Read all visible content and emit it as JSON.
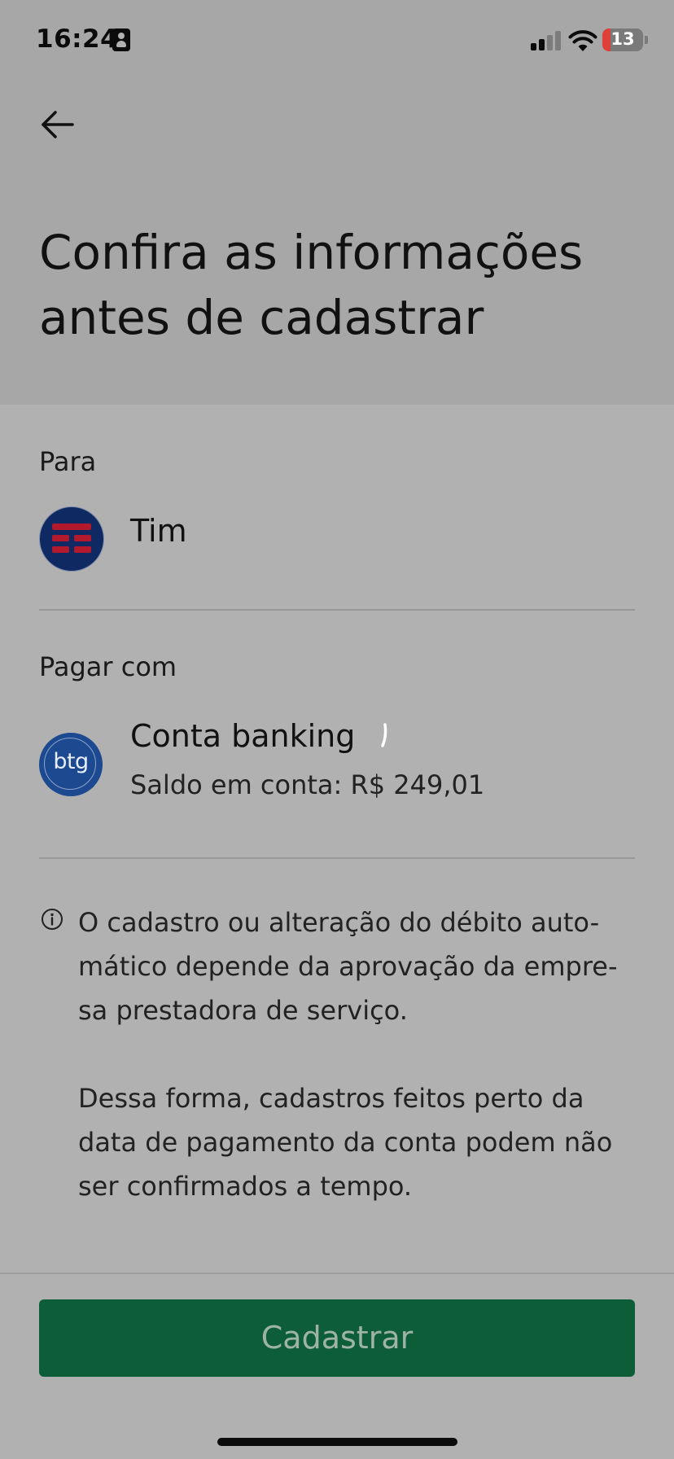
{
  "status_bar": {
    "time": "16:24",
    "battery_level": "13",
    "battery_color": "#e0403a",
    "id_icon": "person-id-icon",
    "signal_icon": "cellular-signal-icon",
    "wifi_icon": "wifi-icon"
  },
  "header": {
    "back_icon": "arrow-left-icon",
    "title_line1": "Confira as informações",
    "title_line2": "antes de cadastrar"
  },
  "recipient": {
    "label": "Para",
    "name": "Tim",
    "avatar_icon": "tim-logo-icon"
  },
  "payment": {
    "label": "Pagar com",
    "account_name": "Conta banking",
    "balance": "Saldo em conta: R$ 249,01",
    "avatar_text": "btg"
  },
  "info": {
    "icon": "info-circle-icon",
    "paragraph1_line1": "O cadastro ou alteração do débito auto-",
    "paragraph1_line2": "mático depende da aprovação da empre-",
    "paragraph1_line3": "sa prestadora de serviço.",
    "paragraph2_line1": "Dessa forma, cadastros feitos perto da",
    "paragraph2_line2": "data de pagamento da conta podem não",
    "paragraph2_line3": "ser confirmados a tempo."
  },
  "footer": {
    "button_label": "Cadastrar"
  },
  "colors": {
    "overlay_background": "#b1b1b1",
    "header_background": "#a7a7a7",
    "primary_button": "#0d5e38",
    "primary_button_text": "#9cb3a6",
    "tim_blue": "#0f2a63",
    "tim_red": "#b3192d",
    "btg_blue": "#1d4991"
  }
}
